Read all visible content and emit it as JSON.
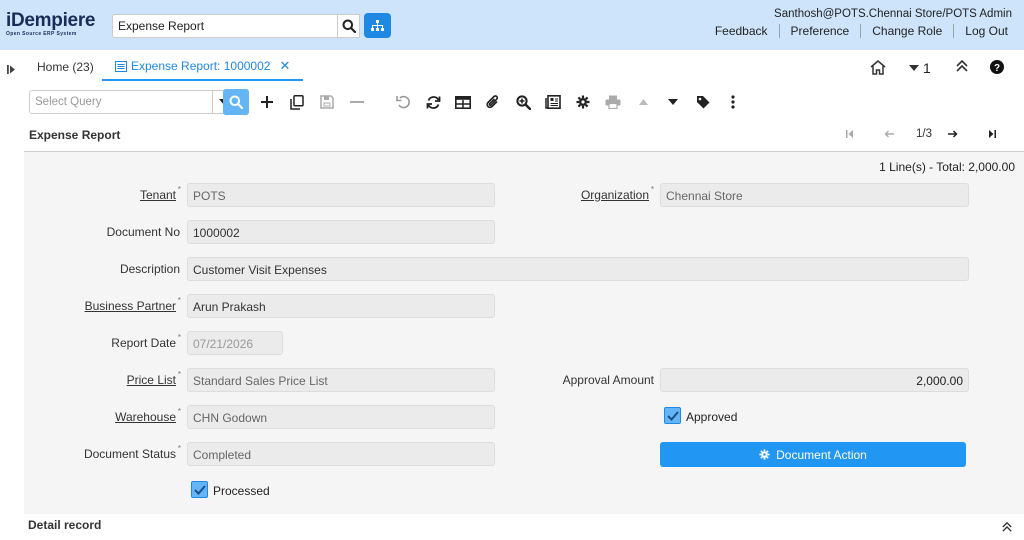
{
  "header": {
    "logo_text": "iDempiere",
    "logo_subtext": "Open Source ERP System",
    "search_value": "Expense Report",
    "user": "Santhosh@POTS.Chennai Store/POTS Admin",
    "links": [
      "Feedback",
      "Preference",
      "Change Role",
      "Log Out"
    ]
  },
  "tabs": {
    "home_label": "Home (23)",
    "active_label": "Expense Report: 1000002",
    "record_counter": "1"
  },
  "toolbar": {
    "query_placeholder": "Select Query"
  },
  "title": {
    "text": "Expense Report",
    "record_position": "1/3"
  },
  "form": {
    "total_text": "1 Line(s) - Total: 2,000.00",
    "tenant_label": "Tenant",
    "tenant_value": "POTS",
    "organization_label": "Organization",
    "organization_value": "Chennai Store",
    "document_no_label": "Document No",
    "document_no_value": "1000002",
    "description_label": "Description",
    "description_value": "Customer Visit Expenses",
    "business_partner_label": "Business Partner",
    "business_partner_value": "Arun Prakash",
    "report_date_label": "Report Date",
    "report_date_value": "07/21/2026",
    "price_list_label": "Price List",
    "price_list_value": "Standard Sales Price List",
    "approval_amount_label": "Approval Amount",
    "approval_amount_value": "2,000.00",
    "warehouse_label": "Warehouse",
    "warehouse_value": "CHN Godown",
    "approved_label": "Approved",
    "approved_checked": true,
    "document_status_label": "Document Status",
    "document_status_value": "Completed",
    "document_action_label": "Document Action",
    "processed_label": "Processed",
    "processed_checked": true
  },
  "detail": {
    "title": "Detail record"
  },
  "colors": {
    "header_bg": "#cde4fb",
    "accent": "#2196f3",
    "form_bg": "#f5f5f5"
  }
}
